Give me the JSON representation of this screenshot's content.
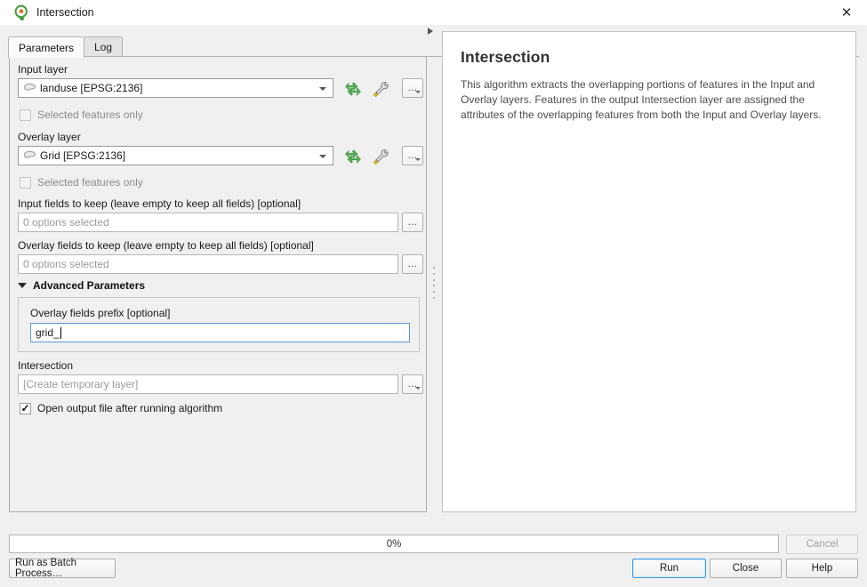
{
  "window": {
    "title": "Intersection",
    "app_icon": "qgis-logo-icon",
    "close_label": "✕"
  },
  "tabs": [
    {
      "label": "Parameters",
      "active": true
    },
    {
      "label": "Log",
      "active": false
    }
  ],
  "parameters": {
    "input_layer": {
      "label": "Input layer",
      "value": "landuse [EPSG:2136]",
      "icon": "polygon-layer-icon",
      "iterate_tooltip": "Iterate over this layer",
      "expression_tooltip": "Advanced options",
      "more_label": "…"
    },
    "input_selected_only": {
      "label": "Selected features only",
      "checked": false,
      "enabled": false
    },
    "overlay_layer": {
      "label": "Overlay layer",
      "value": "Grid [EPSG:2136]",
      "icon": "polygon-layer-icon",
      "more_label": "…"
    },
    "overlay_selected_only": {
      "label": "Selected features only",
      "checked": false,
      "enabled": false
    },
    "input_fields_to_keep": {
      "label": "Input fields to keep (leave empty to keep all fields) [optional]",
      "value": "0 options selected",
      "more_label": "…"
    },
    "overlay_fields_to_keep": {
      "label": "Overlay fields to keep (leave empty to keep all fields) [optional]",
      "value": "0 options selected",
      "more_label": "…"
    },
    "advanced": {
      "header": "Advanced Parameters",
      "expanded": true,
      "overlay_prefix": {
        "label": "Overlay fields prefix [optional]",
        "value": "grid_",
        "focused": true
      }
    },
    "output": {
      "label": "Intersection",
      "placeholder": "[Create temporary layer]",
      "more_label": "…"
    },
    "open_output": {
      "label": "Open output file after running algorithm",
      "checked": true,
      "enabled": true
    }
  },
  "help": {
    "title": "Intersection",
    "body": "This algorithm extracts the overlapping portions of features in the Input and Overlay layers. Features in the output Intersection layer are assigned the attributes of the overlapping features from both the Input and Overlay layers."
  },
  "footer": {
    "progress_text": "0%",
    "progress_percent": 0,
    "cancel_label": "Cancel",
    "cancel_enabled": false,
    "batch_label": "Run as Batch Process…",
    "run_label": "Run",
    "close_label": "Close",
    "help_label": "Help"
  },
  "colors": {
    "accent": "#3f9ae0",
    "refresh_icon": "#4caf50",
    "window_bg": "#f0f0f0",
    "panel_bg": "#ffffff"
  }
}
